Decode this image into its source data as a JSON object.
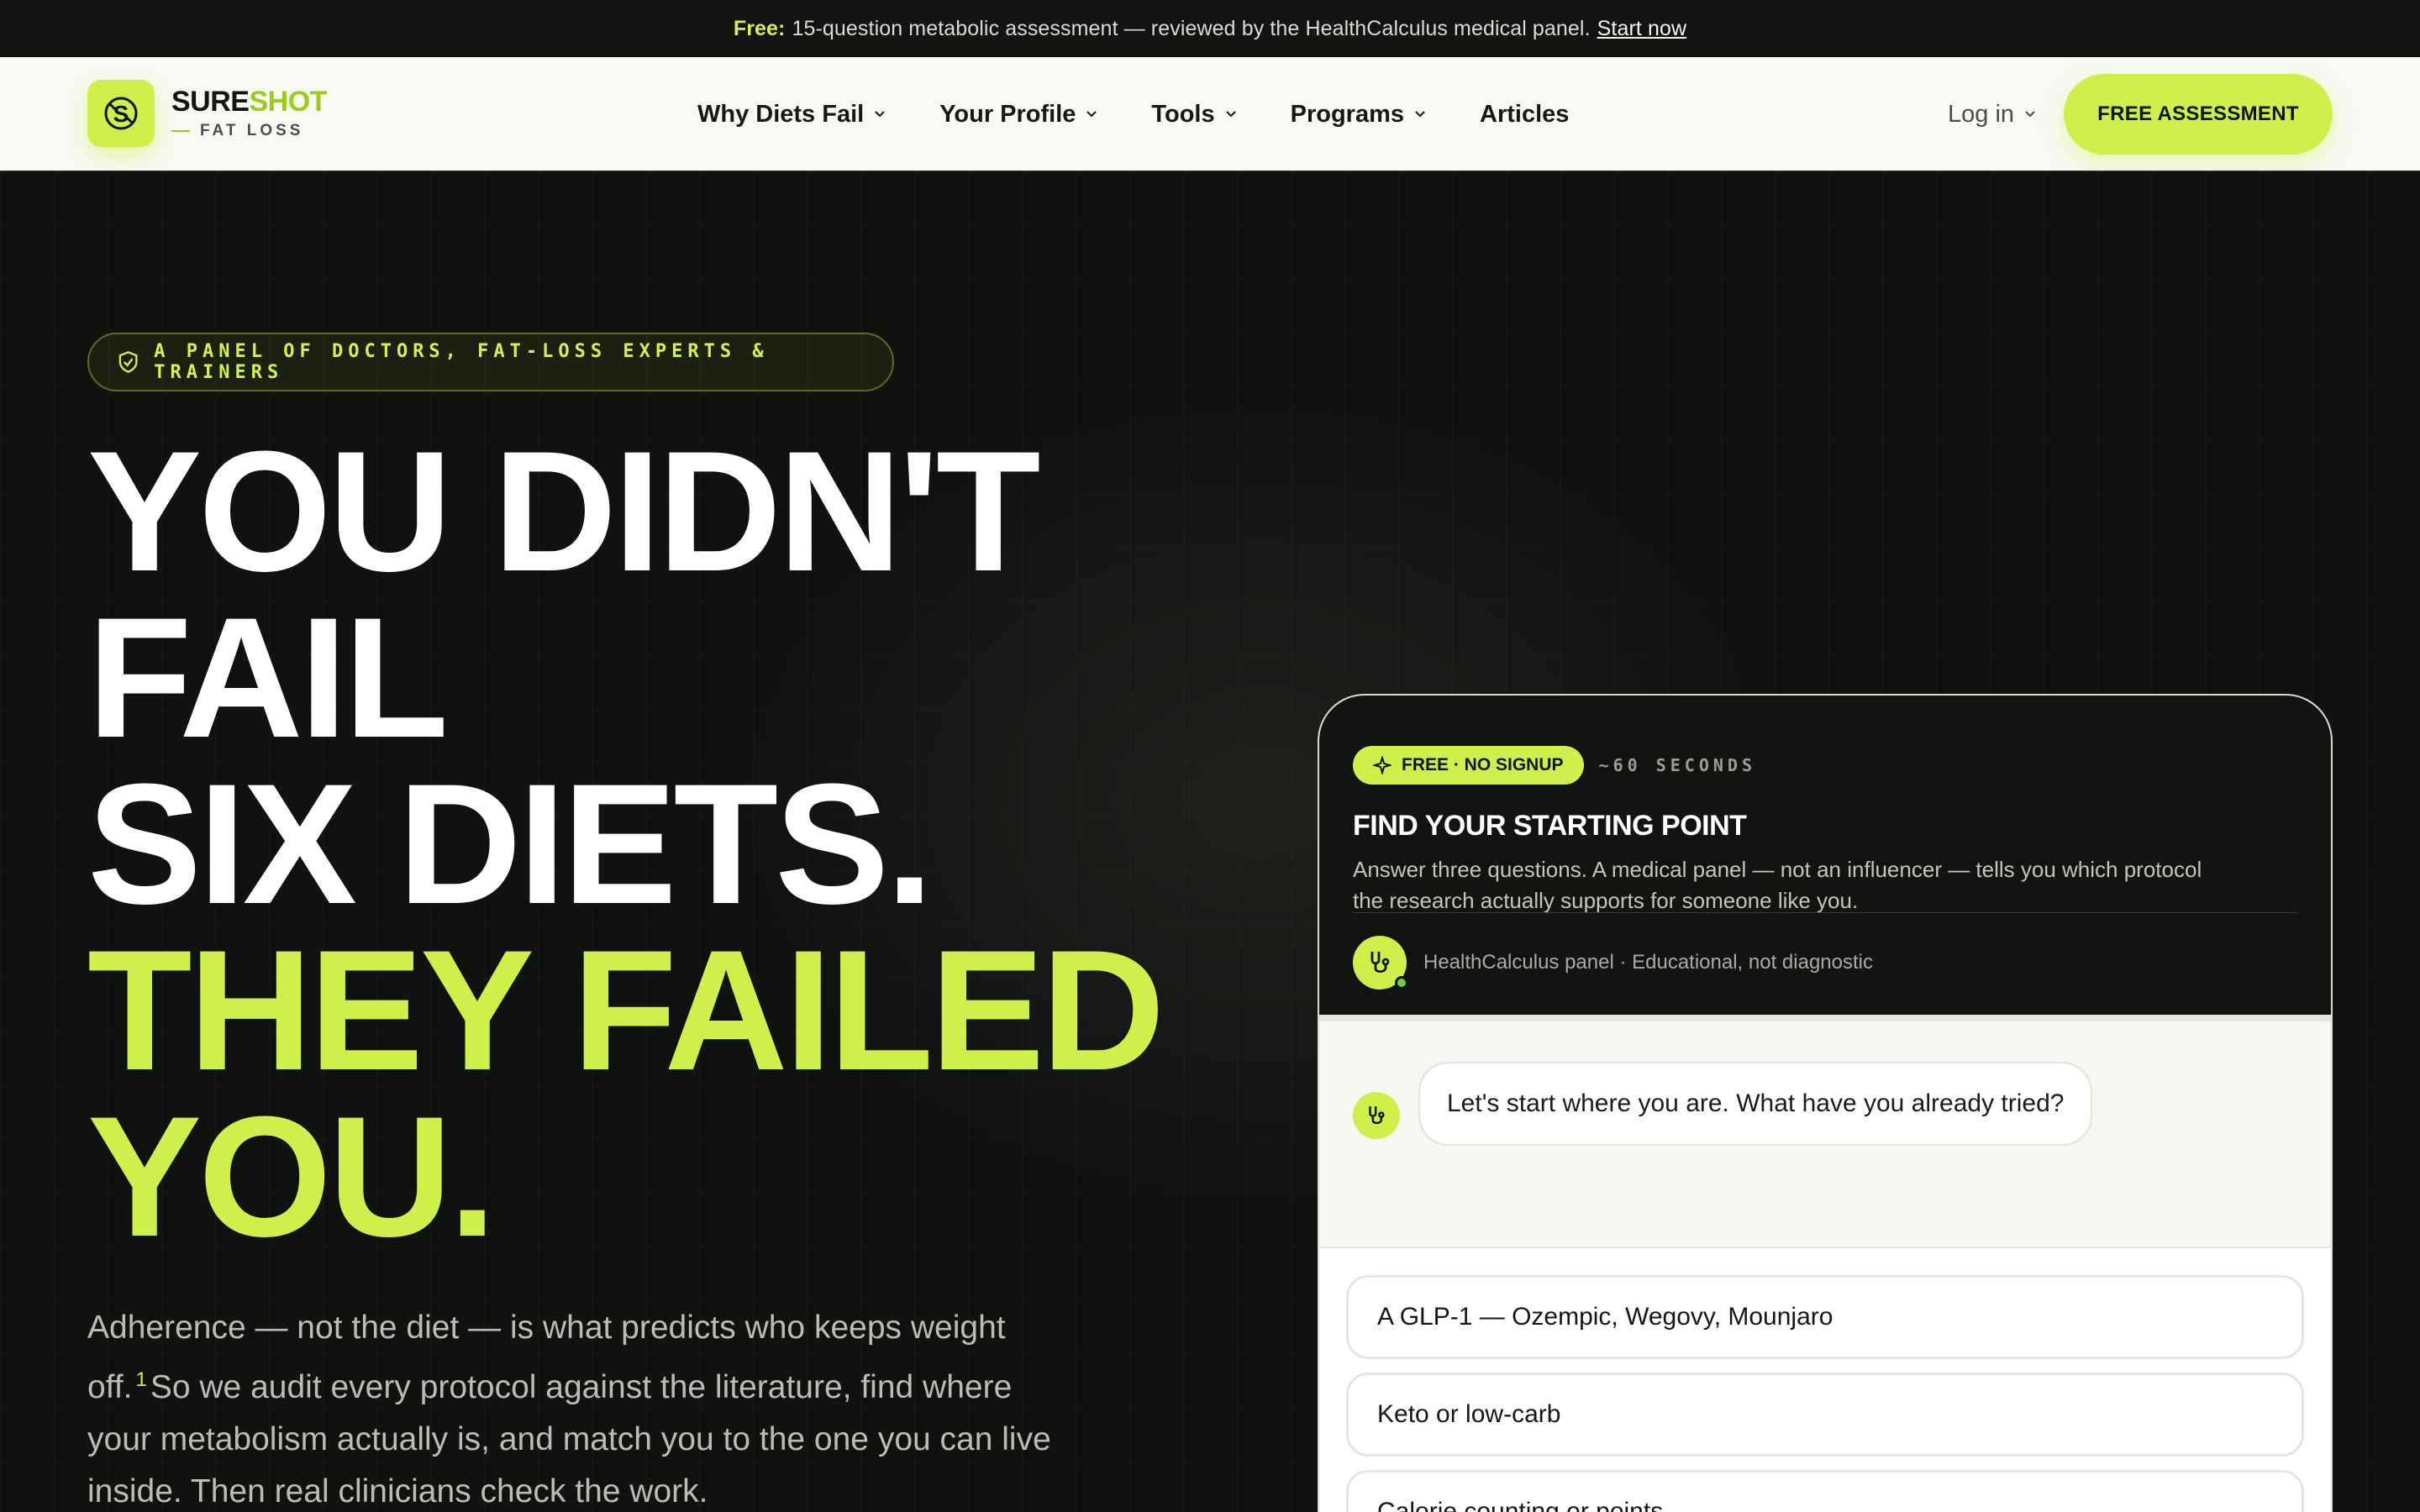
{
  "announcement": {
    "free_label": "Free:",
    "text": "15-question metabolic assessment — reviewed by the HealthCalculus medical panel.",
    "cta": "Start now"
  },
  "nav": {
    "brand": {
      "sure": "SURE",
      "shot": "SHOT",
      "sub": "FAT LOSS"
    },
    "items": [
      {
        "label": "Why Diets Fail",
        "dropdown": true
      },
      {
        "label": "Your Profile",
        "dropdown": true
      },
      {
        "label": "Tools",
        "dropdown": true
      },
      {
        "label": "Programs",
        "dropdown": true
      },
      {
        "label": "Articles",
        "dropdown": false
      }
    ],
    "login": "Log in",
    "cta": "FREE ASSESSMENT"
  },
  "hero": {
    "badge": "A PANEL OF DOCTORS, FAT-LOSS EXPERTS & TRAINERS",
    "headline_white": [
      "YOU DIDN'T",
      "FAIL",
      "SIX DIETS."
    ],
    "headline_green": [
      "THEY FAILED",
      "YOU."
    ],
    "lede_a": "Adherence — not the diet — is what predicts who keeps weight off.",
    "lede_ref": "1",
    "lede_b": "So we audit every protocol against the literature, find where your metabolism actually is, and match you to the one you can live inside. Then real clinicians check the work."
  },
  "quiz": {
    "tag": "FREE · NO SIGNUP",
    "duration": "~60 SECONDS",
    "title": "FIND YOUR STARTING POINT",
    "description": "Answer three questions. A medical panel — not an influencer — tells you which protocol the research actually supports for someone like you.",
    "panel": "HealthCalculus panel · Educational, not diagnostic",
    "question": "Let's start where you are. What have you already tried?",
    "options": [
      "A GLP-1 — Ozempic, Wegovy, Mounjaro",
      "Keto or low-carb",
      "Calorie counting or points"
    ]
  },
  "colors": {
    "accent": "#cff04a",
    "dark": "#121411",
    "light": "#f8f9f3"
  }
}
